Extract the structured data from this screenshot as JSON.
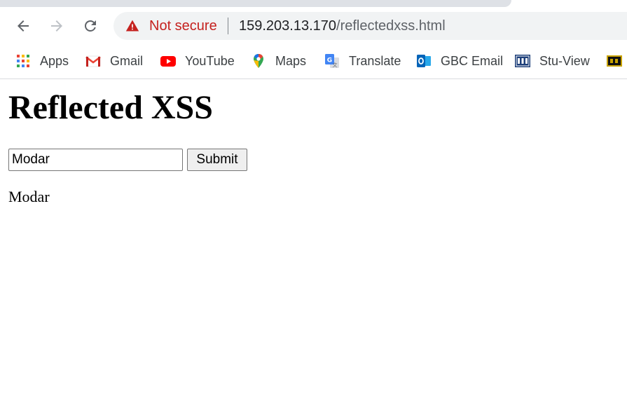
{
  "browser": {
    "security_label": "Not secure",
    "url_host": "159.203.13.170",
    "url_path": "/reflectedxss.html",
    "colors": {
      "warning": "#c5221f",
      "omnibox_bg": "#f1f3f4"
    }
  },
  "bookmarks": [
    {
      "label": "Apps",
      "icon": "apps-grid-icon"
    },
    {
      "label": "Gmail",
      "icon": "gmail-icon"
    },
    {
      "label": "YouTube",
      "icon": "youtube-icon"
    },
    {
      "label": "Maps",
      "icon": "maps-pin-icon"
    },
    {
      "label": "Translate",
      "icon": "translate-icon"
    },
    {
      "label": "GBC Email",
      "icon": "outlook-icon"
    },
    {
      "label": "Stu-View",
      "icon": "gbc-logo-icon"
    }
  ],
  "page": {
    "title": "Reflected XSS",
    "input_value": "Modar",
    "submit_label": "Submit",
    "reflected_text": "Modar"
  }
}
